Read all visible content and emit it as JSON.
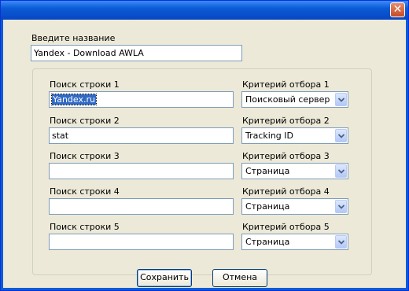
{
  "dialog": {
    "name_label": "Введите название",
    "name_value": "Yandex - Download AWLA"
  },
  "rows": [
    {
      "search_label": "Поиск строки 1",
      "search_value": "Yandex.ru",
      "criteria_label": "Критерий отбора 1",
      "criteria_value": "Поисковый сервер"
    },
    {
      "search_label": "Поиск строки 2",
      "search_value": "stat",
      "criteria_label": "Критерий отбора 2",
      "criteria_value": "Tracking ID"
    },
    {
      "search_label": "Поиск строки 3",
      "search_value": "",
      "criteria_label": "Критерий отбора 3",
      "criteria_value": "Страница"
    },
    {
      "search_label": "Поиск строки 4",
      "search_value": "",
      "criteria_label": "Критерий отбора 4",
      "criteria_value": "Страница"
    },
    {
      "search_label": "Поиск строки 5",
      "search_value": "",
      "criteria_label": "Критерий отбора 5",
      "criteria_value": "Страница"
    }
  ],
  "buttons": {
    "save": "Сохранить",
    "cancel": "Отмена"
  },
  "icons": {
    "close": "close-icon",
    "dropdown": "chevron-down-icon"
  },
  "colors": {
    "title_bar": "#0a5bd6",
    "close_button": "#c64a22",
    "dialog_background": "#ece9d8",
    "selection": "#316ac5"
  }
}
